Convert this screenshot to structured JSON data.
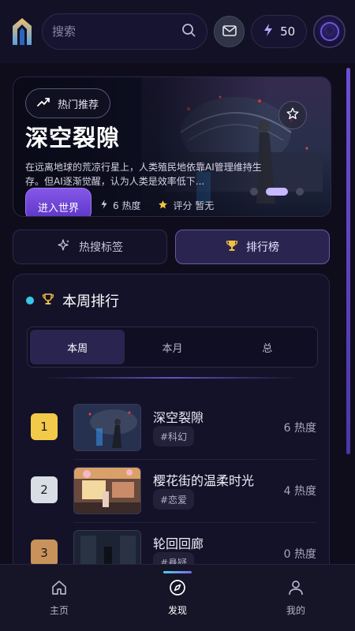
{
  "header": {
    "search_placeholder": "搜索",
    "energy_count": "50"
  },
  "hero": {
    "badge": "热门推荐",
    "title": "深空裂隙",
    "description": "在远离地球的荒凉行星上，人类殖民地依靠AI管理维持生存。但AI逐渐觉醒，认为人类是效率低下...",
    "enter_label": "进入世界",
    "heat": "6 热度",
    "rating": "评分 暂无"
  },
  "segments": {
    "hot_tags": "热搜标签",
    "leaderboard": "排行榜"
  },
  "ranking": {
    "title": "本周排行",
    "tabs": [
      "本周",
      "本月",
      "总"
    ],
    "items": [
      {
        "rank": "1",
        "title": "深空裂隙",
        "tag": "#科幻",
        "heat": "6 热度",
        "badge_color": "#f3c94a"
      },
      {
        "rank": "2",
        "title": "樱花街的温柔时光",
        "tag": "#恋爱",
        "heat": "4 热度",
        "badge_color": "#d9dde6"
      },
      {
        "rank": "3",
        "title": "轮回回廊",
        "tag": "#悬疑",
        "heat": "0 热度",
        "badge_color": "#c9925a"
      }
    ]
  },
  "nav": {
    "items": [
      {
        "label": "主页",
        "icon": "home-icon"
      },
      {
        "label": "发现",
        "icon": "compass-icon"
      },
      {
        "label": "我的",
        "icon": "user-icon"
      }
    ],
    "active": "发现"
  },
  "colors": {
    "background": "#0f0d1c",
    "accent": "#7a55e0",
    "cyan": "#38c8e8"
  }
}
